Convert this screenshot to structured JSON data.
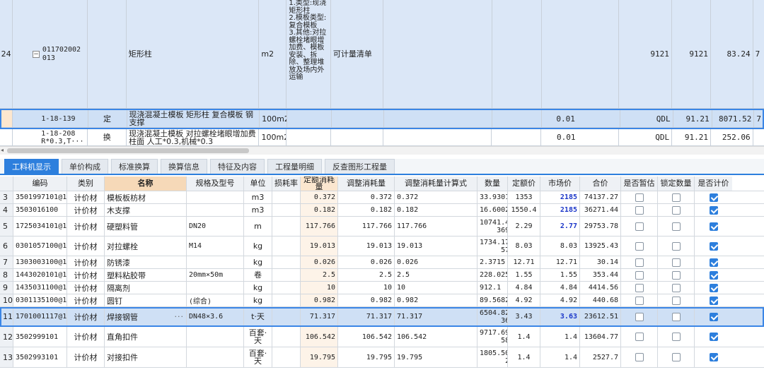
{
  "top_rows": [
    {
      "no": "24",
      "code": "011702002013",
      "type": "",
      "name": "矩形柱",
      "unit": "m2",
      "desc": "1.类型:现浇矩形柱\n2.模板类型:复合模板\n3.其他:对拉螺栓堵眼增加费、模板安装、拆除、整理堆放及场内外运输",
      "calc": "可计量清单",
      "qty": "",
      "price_code": "9121",
      "v1": "9121",
      "v2": "83.24",
      "v3": "7"
    },
    {
      "no": "",
      "code": "1-18-139",
      "type": "定",
      "name": "现浇混凝土模板 矩形柱 复合模板 钢支撑",
      "unit": "100m2",
      "desc": "",
      "calc": "",
      "qty": "0.01",
      "price_code": "QDL",
      "v1": "91.21",
      "v2": "8071.52",
      "v3": "7"
    },
    {
      "no": "",
      "code": "1-18-208 R*0.3,T···",
      "type": "换",
      "name": "现浇混凝土模板 对拉螺栓堵眼增加费 柱面 人工*0.3,机械*0.3",
      "unit": "100m2",
      "desc": "",
      "calc": "",
      "qty": "0.01",
      "price_code": "QDL",
      "v1": "91.21",
      "v2": "252.06",
      "v3": ""
    }
  ],
  "tabs": [
    "工料机显示",
    "单价构成",
    "标准换算",
    "换算信息",
    "特征及内容",
    "工程量明细",
    "反查图形工程量"
  ],
  "grid_headers": [
    "编码",
    "类别",
    "名称",
    "规格及型号",
    "单位",
    "损耗率",
    "定额消耗量",
    "调整消耗量",
    "调整消耗量计算式",
    "数量",
    "定额价",
    "市场价",
    "合价",
    "是否暂估",
    "锁定数量",
    "是否计价"
  ],
  "grid_rows": [
    {
      "idx": "3",
      "code": "3501997101@1",
      "cat": "计价材",
      "name": "模板板枋材",
      "spec": "",
      "unit": "m3",
      "loss": "",
      "quota": "0.372",
      "adj": "0.372",
      "formula": "0.372",
      "qty": "33.9301",
      "dprice": "1353",
      "mprice": "2185",
      "mblue": true,
      "total": "74137.27",
      "est": false,
      "lock": false,
      "price": true
    },
    {
      "idx": "4",
      "code": "3503016100",
      "cat": "计价材",
      "name": "木支撑",
      "spec": "",
      "unit": "m3",
      "loss": "",
      "quota": "0.182",
      "adj": "0.182",
      "formula": "0.182",
      "qty": "16.6002",
      "dprice": "1550.4",
      "mprice": "2185",
      "mblue": true,
      "total": "36271.44",
      "est": false,
      "lock": false,
      "price": true
    },
    {
      "idx": "5",
      "code": "1725034101@1",
      "cat": "计价材",
      "name": "硬塑料管",
      "spec": "DN20",
      "unit": "m",
      "loss": "",
      "quota": "117.766",
      "adj": "117.766",
      "formula": "117.766",
      "qty": "10741.4\n369",
      "dprice": "2.29",
      "mprice": "2.77",
      "mblue": true,
      "total": "29753.78",
      "est": false,
      "lock": false,
      "price": true
    },
    {
      "idx": "6",
      "code": "0301057100@1",
      "cat": "计价材",
      "name": "对拉螺栓",
      "spec": "M14",
      "unit": "kg",
      "loss": "",
      "quota": "19.013",
      "adj": "19.013",
      "formula": "19.013",
      "qty": "1734.17\n57",
      "dprice": "8.03",
      "mprice": "8.03",
      "mblue": false,
      "total": "13925.43",
      "est": false,
      "lock": false,
      "price": true
    },
    {
      "idx": "7",
      "code": "1303003100@1",
      "cat": "计价材",
      "name": "防锈漆",
      "spec": "",
      "unit": "kg",
      "loss": "",
      "quota": "0.026",
      "adj": "0.026",
      "formula": "0.026",
      "qty": "2.3715",
      "dprice": "12.71",
      "mprice": "12.71",
      "mblue": false,
      "total": "30.14",
      "est": false,
      "lock": false,
      "price": true
    },
    {
      "idx": "8",
      "code": "1443020101@1",
      "cat": "计价材",
      "name": "塑料粘胶带",
      "spec": "20mm×50m",
      "unit": "卷",
      "loss": "",
      "quota": "2.5",
      "adj": "2.5",
      "formula": "2.5",
      "qty": "228.025",
      "dprice": "1.55",
      "mprice": "1.55",
      "mblue": false,
      "total": "353.44",
      "est": false,
      "lock": false,
      "price": true
    },
    {
      "idx": "9",
      "code": "1435031100@1",
      "cat": "计价材",
      "name": "隔离剂",
      "spec": "",
      "unit": "kg",
      "loss": "",
      "quota": "10",
      "adj": "10",
      "formula": "10",
      "qty": "912.1",
      "dprice": "4.84",
      "mprice": "4.84",
      "mblue": false,
      "total": "4414.56",
      "est": false,
      "lock": false,
      "price": true
    },
    {
      "idx": "10",
      "code": "0301135100@1",
      "cat": "计价材",
      "name": "圆钉",
      "spec": "(综合)",
      "unit": "kg",
      "loss": "",
      "quota": "0.982",
      "adj": "0.982",
      "formula": "0.982",
      "qty": "89.5682",
      "dprice": "4.92",
      "mprice": "4.92",
      "mblue": false,
      "total": "440.68",
      "est": false,
      "lock": false,
      "price": true
    },
    {
      "idx": "11",
      "code": "1701001117@1",
      "cat": "计价材",
      "name": "焊接钢管",
      "spec": "DN48×3.6",
      "unit": "t·天",
      "loss": "",
      "quota": "71.317",
      "adj": "71.317",
      "formula": "71.317",
      "qty": "6504.82\n36",
      "dprice": "3.43",
      "mprice": "3.63",
      "mblue": true,
      "total": "23612.51",
      "est": false,
      "lock": false,
      "price": true,
      "selected": true
    },
    {
      "idx": "12",
      "code": "3502999101",
      "cat": "计价材",
      "name": "直角扣件",
      "spec": "",
      "unit": "百套·\n天",
      "loss": "",
      "quota": "106.542",
      "adj": "106.542",
      "formula": "106.542",
      "qty": "9717.69\n58",
      "dprice": "1.4",
      "mprice": "1.4",
      "mblue": false,
      "total": "13604.77",
      "est": false,
      "lock": false,
      "price": true
    },
    {
      "idx": "13",
      "code": "3502993101",
      "cat": "计价材",
      "name": "对接扣件",
      "spec": "",
      "unit": "百套·\n天",
      "loss": "",
      "quota": "19.795",
      "adj": "19.795",
      "formula": "19.795",
      "qty": "1805.50\n2",
      "dprice": "1.4",
      "mprice": "1.4",
      "mblue": false,
      "total": "2527.7",
      "est": false,
      "lock": false,
      "price": true
    }
  ],
  "colors": {
    "accent": "#2d7fdd",
    "selection": "#cfe0f5",
    "row_blue": "#dbe7f7",
    "market_price_blue": "#1b36c8"
  }
}
